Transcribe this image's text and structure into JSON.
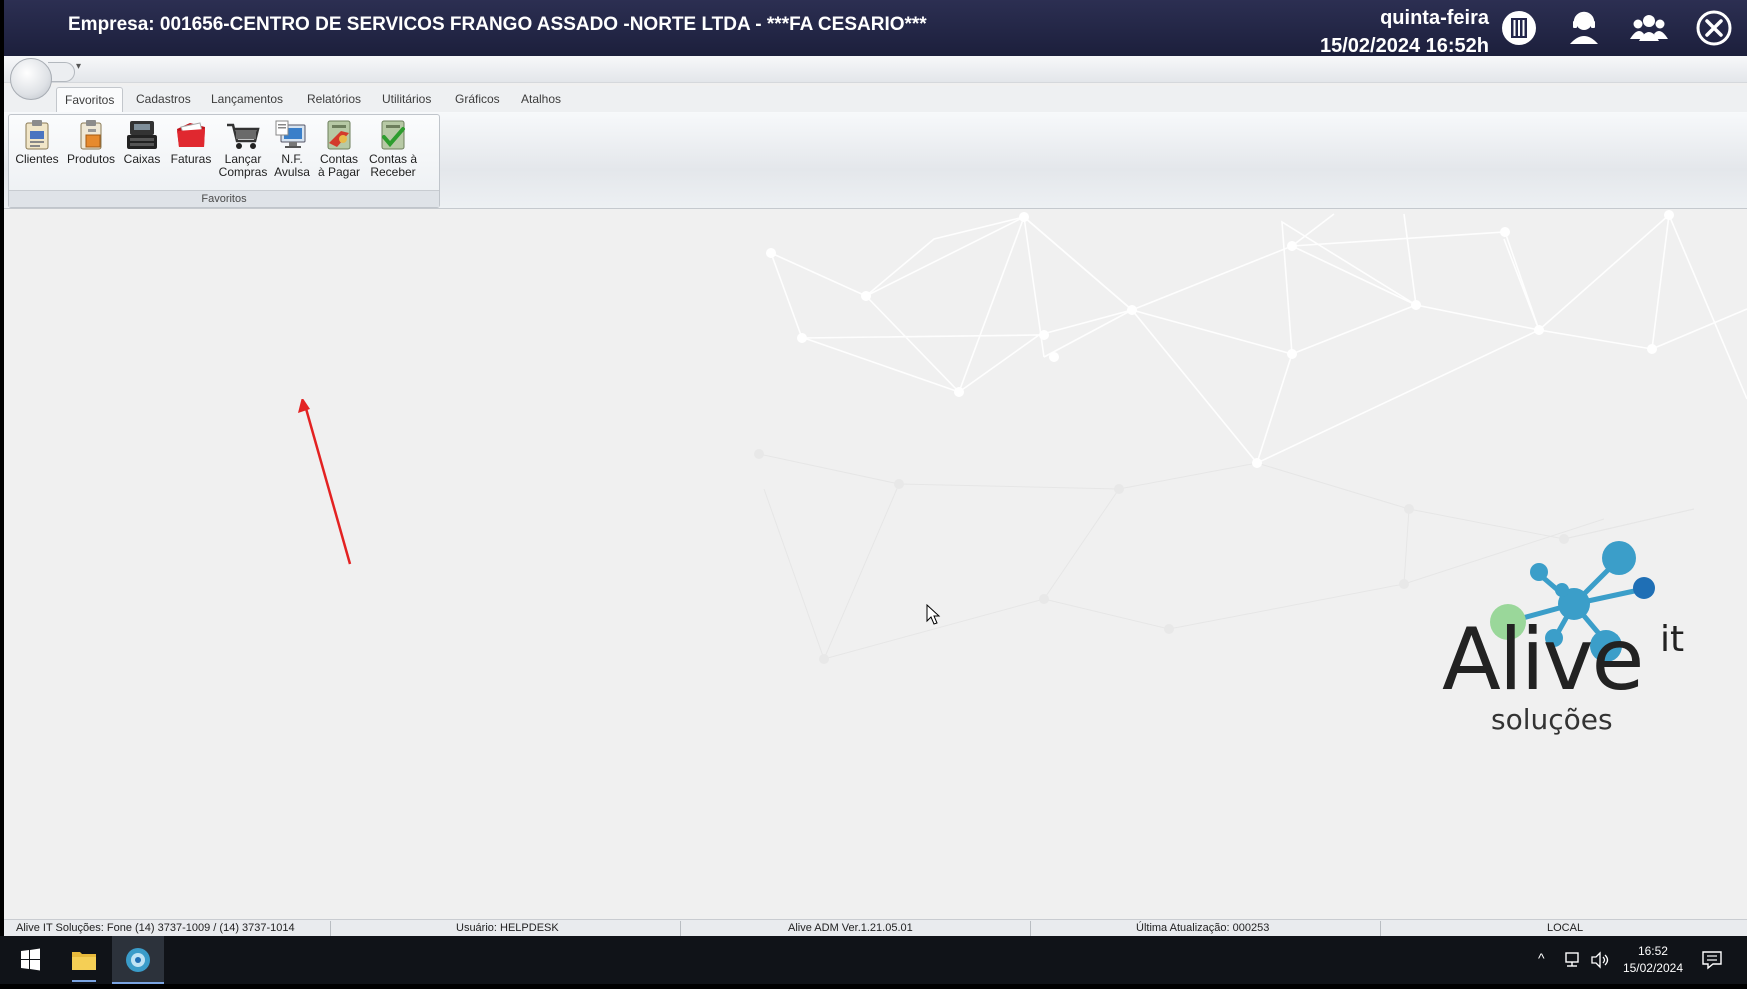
{
  "titlebar": {
    "company": "Empresa: 001656-CENTRO DE SERVICOS FRANGO ASSADO -NORTE LTDA - ***FA CESARIO***",
    "weekday": "quinta-feira",
    "datetime": "15/02/2024 16:52h",
    "icons": [
      "building-icon",
      "support-agent-icon",
      "users-group-icon",
      "close-circle-icon"
    ]
  },
  "tabs": [
    {
      "label": "Favoritos",
      "active": true
    },
    {
      "label": "Cadastros"
    },
    {
      "label": "Lançamentos"
    },
    {
      "label": "Relatórios"
    },
    {
      "label": "Utilitários"
    },
    {
      "label": "Gráficos"
    },
    {
      "label": "Atalhos"
    }
  ],
  "ribbon": {
    "group_label": "Favoritos",
    "buttons": [
      {
        "line1": "Clientes",
        "line2": "",
        "icon": "clients-icon"
      },
      {
        "line1": "Produtos",
        "line2": "",
        "icon": "products-icon"
      },
      {
        "line1": "Caixas",
        "line2": "",
        "icon": "cash-register-icon"
      },
      {
        "line1": "Faturas",
        "line2": "",
        "icon": "invoices-icon"
      },
      {
        "line1": "Lançar",
        "line2": "Compras",
        "icon": "shopping-cart-icon"
      },
      {
        "line1": "N.F.",
        "line2": "Avulsa",
        "icon": "invoice-computer-icon"
      },
      {
        "line1": "Contas",
        "line2": "à Pagar",
        "icon": "accounts-payable-icon"
      },
      {
        "line1": "Contas à",
        "line2": "Receber",
        "icon": "accounts-receivable-icon"
      }
    ]
  },
  "logo": {
    "word": "Alive",
    "superscript": "it",
    "sub": "soluções"
  },
  "statusbar": {
    "contact": "Alive IT Soluções: Fone (14) 3737-1009 / (14) 3737-1014",
    "user": "Usuário: HELPDESK",
    "version": "Alive ADM Ver.1.21.05.01",
    "update": "Última Atualização: 000253",
    "mode": "LOCAL"
  },
  "taskbar": {
    "time": "16:52",
    "date": "15/02/2024",
    "apps": [
      "windows-start-icon",
      "file-explorer-icon",
      "alive-app-icon"
    ]
  },
  "colors": {
    "titlebar": "#22254a",
    "accent": "#e32222",
    "logo_blue": "#3a9cc9",
    "logo_green": "#8fd08a"
  }
}
